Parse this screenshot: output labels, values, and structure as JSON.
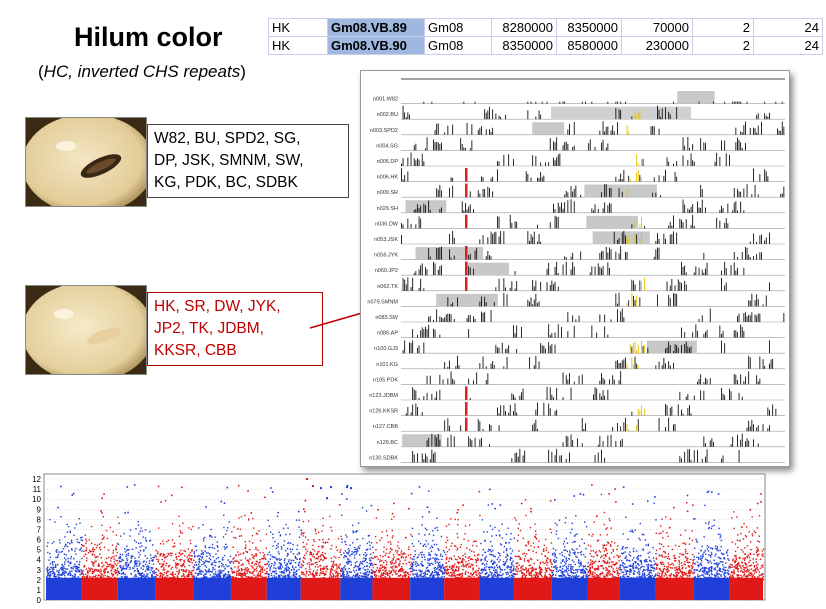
{
  "title": "Hilum color",
  "subtitle": "(HC, inverted CHS repeats)",
  "subtitle_prefix": "(",
  "subtitle_italic": "HC, inverted CHS repeats",
  "subtitle_suffix": ")",
  "table_rows": [
    {
      "line": "HK",
      "id": "Gm08.VB.89",
      "chr": "Gm08",
      "start": "8280000",
      "end": "8350000",
      "len": "70000",
      "n1": "2",
      "n2": "24"
    },
    {
      "line": "HK",
      "id": "Gm08.VB.90",
      "chr": "Gm08",
      "start": "8350000",
      "end": "8580000",
      "len": "230000",
      "n1": "2",
      "n2": "24"
    }
  ],
  "black_group_lines": [
    "W82, BU, SPD2, SG,",
    "DP, JSK, SMNM, SW,",
    "KG, PDK, BC, SDBK"
  ],
  "red_group_lines": [
    "HK, SR, DW, JYK,",
    "JP2, TK, JDBM,",
    "KKSR, CBB"
  ],
  "tracks": [
    "n001.W82",
    "n002.BU",
    "n003.SPD2",
    "n004.SG",
    "n005.DP",
    "n006.HK",
    "n009.SR",
    "n029.SH",
    "n036.DW",
    "n053.JSK",
    "n056.JYK",
    "n060.JP2",
    "n062.TK",
    "n079.SMNM",
    "n083.SW",
    "n086.AP",
    "n100.GJ3",
    "n101.KG",
    "n105.PDK",
    "n123.JDBM",
    "n126.KKSR",
    "n127.CBB",
    "n129.BC",
    "n130.SDBK"
  ],
  "manhattan": {
    "y_ticks": [
      "0",
      "1",
      "2",
      "3",
      "4",
      "5",
      "6",
      "7",
      "8",
      "9",
      "10",
      "11",
      "12"
    ],
    "colors": {
      "blue": "#1f3fd8",
      "red": "#e01818"
    },
    "marker_color": "#e02010"
  },
  "colors": {
    "highlight": "#9fb8e0",
    "red_text": "#c00000",
    "track_red": "#e02020",
    "track_yellow": "#e8c000"
  }
}
